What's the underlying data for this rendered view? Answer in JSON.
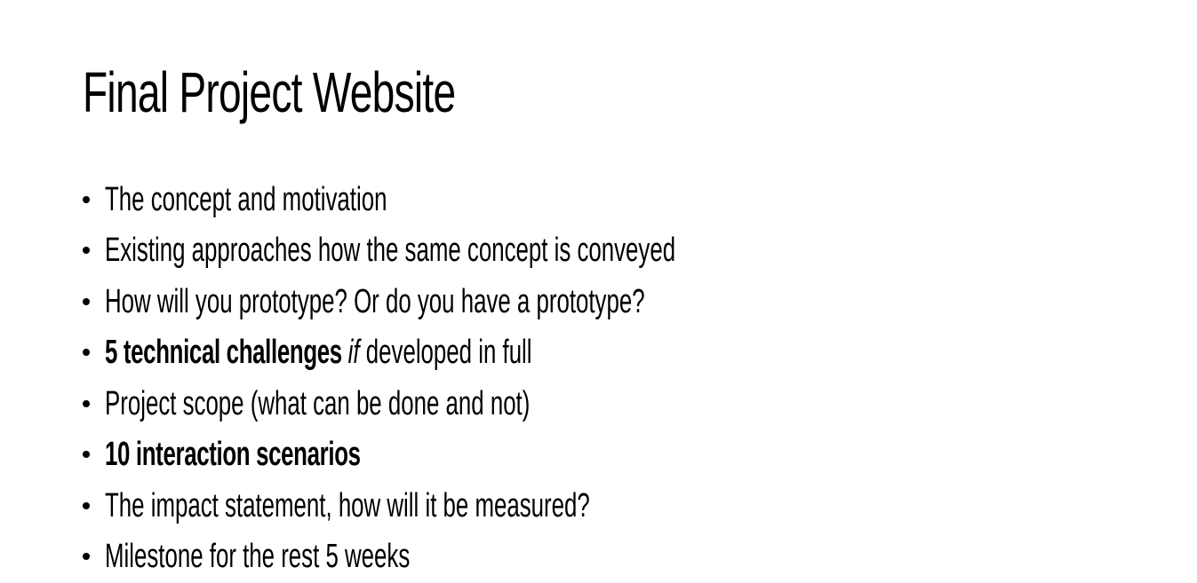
{
  "slide": {
    "title": "Final Project Website",
    "bullets": [
      {
        "bold": "",
        "italic": "",
        "text": "The concept and motivation"
      },
      {
        "bold": "",
        "italic": "",
        "text": "Existing approaches how the same concept is conveyed"
      },
      {
        "bold": "",
        "italic": "",
        "text": "How will you prototype? Or do you have a prototype?"
      },
      {
        "bold": "5 technical challenges ",
        "italic": "if ",
        "text": "developed in full"
      },
      {
        "bold": "",
        "italic": "",
        "text": "Project scope (what can be done and not)"
      },
      {
        "bold": "10 interaction scenarios",
        "italic": "",
        "text": ""
      },
      {
        "bold": "",
        "italic": "",
        "text": "The impact statement, how will it be measured?"
      },
      {
        "bold": "",
        "italic": "",
        "text": "Milestone for the rest 5 weeks"
      }
    ]
  }
}
